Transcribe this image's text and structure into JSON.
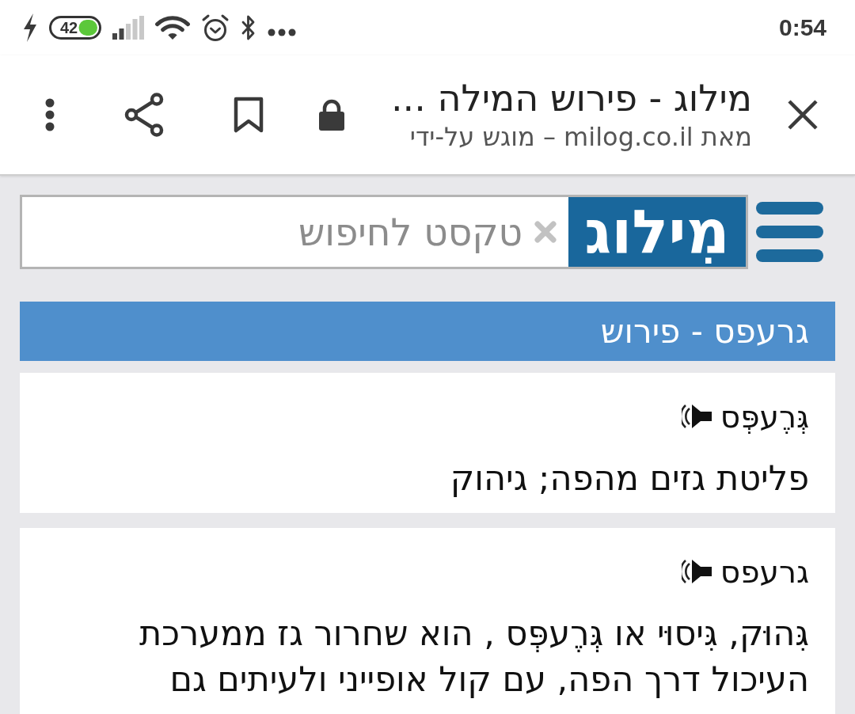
{
  "status_bar": {
    "charging": true,
    "battery": "42",
    "time": "0:54"
  },
  "toolbar": {
    "title": "מילוג - פירוש המילה ...",
    "subtitle": "מאת milog.co.il – מוגש על-ידי"
  },
  "search": {
    "placeholder": "טקסט לחיפוש",
    "logo": "מִילוג"
  },
  "heading": "גרעפס - פירוש",
  "entries": [
    {
      "word": "גְּרֶעפְּס",
      "definition": "פליטת גזים מהפה; גיהוק"
    },
    {
      "word": "גרעפס",
      "definition": "גִּהוּק, גִּיסוּי או גְּרֶעפְּס , הוא שחרור גז ממערכת העיכול דרך הפה, עם קול אופייני ולעיתים גם"
    }
  ]
}
